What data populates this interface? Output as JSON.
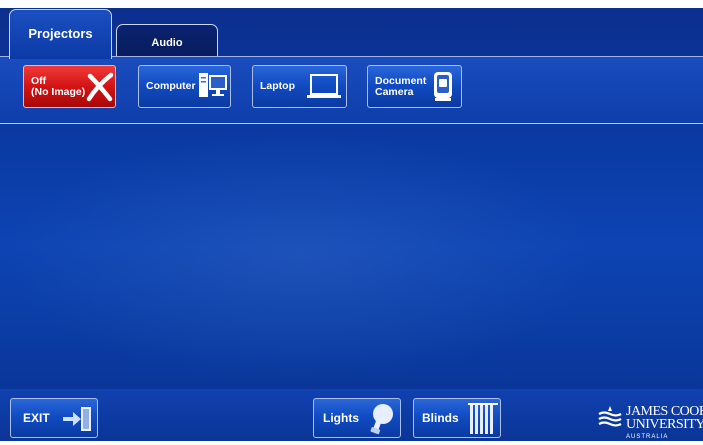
{
  "tabs": [
    {
      "label": "Projectors",
      "active": true
    },
    {
      "label": "Audio",
      "active": false
    }
  ],
  "sources": [
    {
      "label": "Off\n(No Image)",
      "icon": "x-icon",
      "color": "#d31313"
    },
    {
      "label": "Computer",
      "icon": "computer-icon"
    },
    {
      "label": "Laptop",
      "icon": "laptop-icon"
    },
    {
      "label": "Document\nCamera",
      "icon": "document-camera-icon"
    }
  ],
  "bottom": {
    "exit_label": "EXIT",
    "lights_label": "Lights",
    "blinds_label": "Blinds"
  },
  "logo": {
    "line1": "JAMES COOK",
    "line2": "UNIVERSITY",
    "line3": "AUSTRALIA"
  },
  "colors": {
    "background": "#0d44b3",
    "accent": "#2a67d8",
    "off_button": "#d31313"
  }
}
